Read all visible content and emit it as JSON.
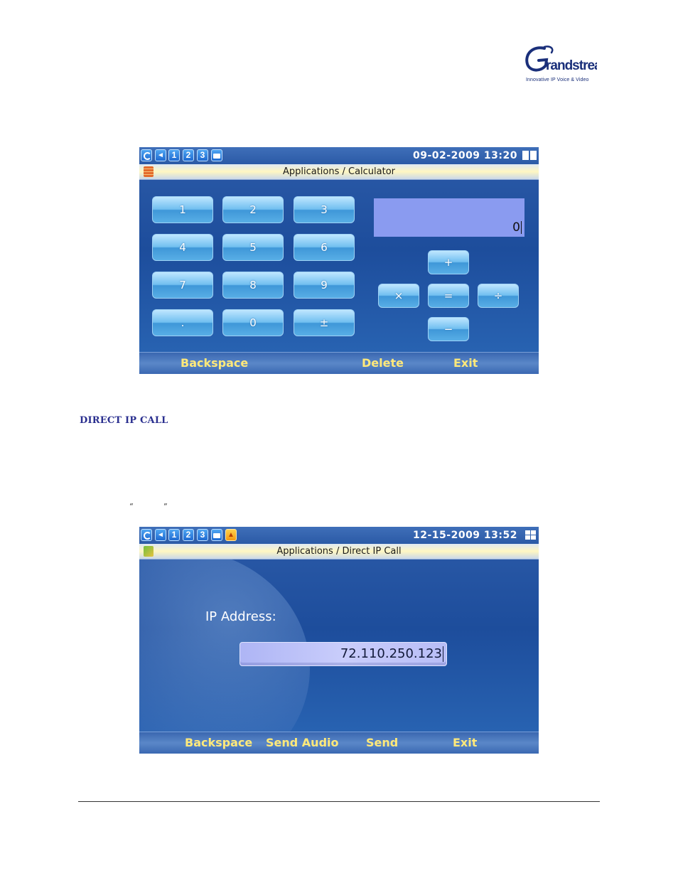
{
  "logo": {
    "brand": "Grandstream",
    "tagline": "Innovative IP Voice & Video"
  },
  "calculator_screen": {
    "status": {
      "icons": [
        "sync-icon",
        "speaker-icon",
        "1",
        "2",
        "3",
        "folder-icon"
      ],
      "datetime": "09-02-2009 13:20"
    },
    "title": "Applications / Calculator",
    "keys": [
      "1",
      "2",
      "3",
      "4",
      "5",
      "6",
      "7",
      "8",
      "9",
      ".",
      "0",
      "±"
    ],
    "operators": {
      "plus": "+",
      "multiply": "×",
      "equals": "=",
      "divide": "÷",
      "minus": "−"
    },
    "display": "0",
    "softkeys": {
      "backspace": "Backspace",
      "delete": "Delete",
      "exit": "Exit"
    }
  },
  "section_heading": "DIRECT IP CALL",
  "quote": {
    "open": "“",
    "close": "”"
  },
  "direct_ip_screen": {
    "status": {
      "icons": [
        "sync-icon",
        "speaker-icon",
        "1",
        "2",
        "3",
        "folder-icon",
        "alert-icon"
      ],
      "datetime": "12-15-2009 13:52"
    },
    "title": "Applications / Direct IP Call",
    "ip_label": "IP Address:",
    "ip_value": "72.110.250.123",
    "softkeys": {
      "backspace": "Backspace",
      "send_audio": "Send Audio",
      "send": "Send",
      "exit": "Exit"
    }
  }
}
